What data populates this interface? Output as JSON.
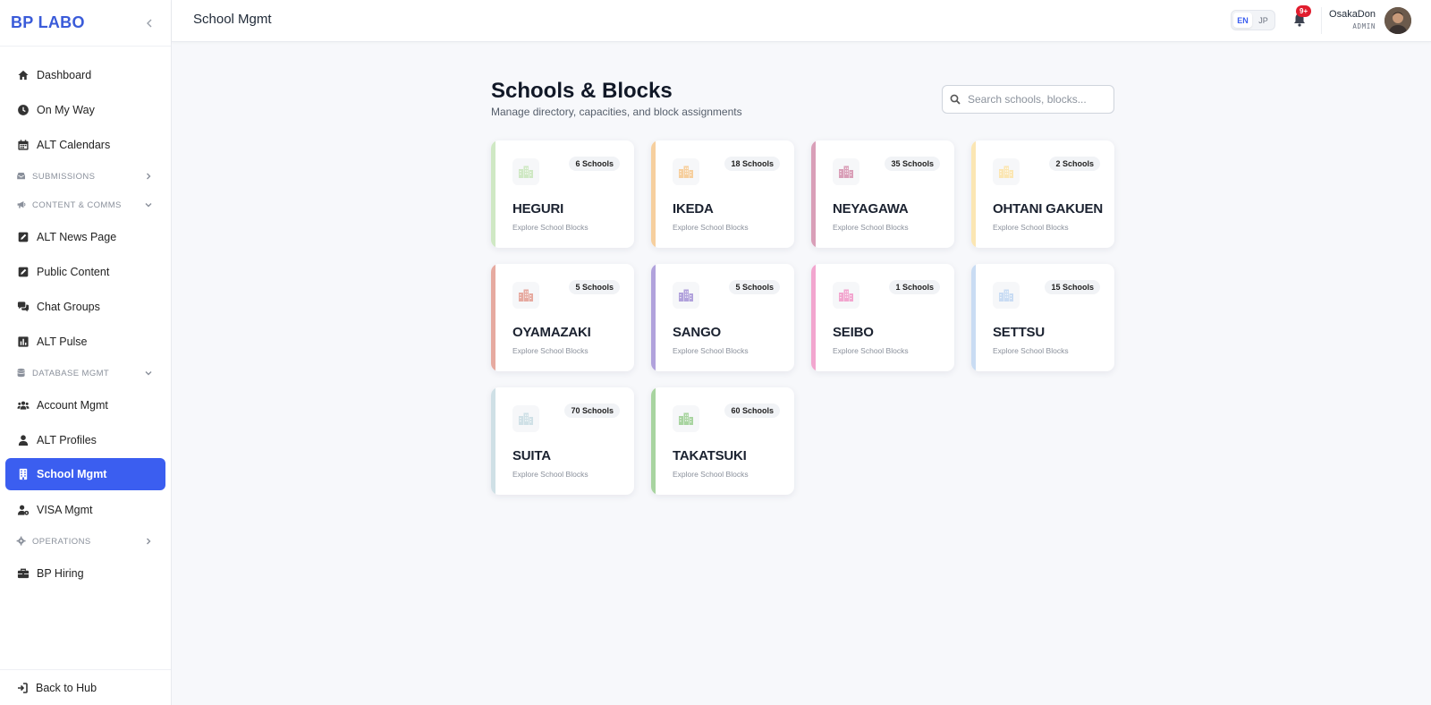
{
  "sidebar": {
    "brand": "BP LABO",
    "items": [
      {
        "type": "item",
        "label": "Dashboard",
        "icon": "home-icon",
        "name": "sidebar-item-dashboard"
      },
      {
        "type": "item",
        "label": "On My Way",
        "icon": "clock-icon",
        "name": "sidebar-item-on-my-way"
      },
      {
        "type": "item",
        "label": "ALT Calendars",
        "icon": "calendar-icon",
        "name": "sidebar-item-alt-calendars"
      },
      {
        "type": "section",
        "label": "SUBMISSIONS",
        "icon": "inbox-icon",
        "chevron": "right",
        "name": "sidebar-section-submissions"
      },
      {
        "type": "section",
        "label": "CONTENT & COMMS",
        "icon": "megaphone-icon",
        "chevron": "down",
        "name": "sidebar-section-content-comms"
      },
      {
        "type": "item",
        "label": "ALT News Page",
        "icon": "edit-icon",
        "name": "sidebar-item-alt-news-page"
      },
      {
        "type": "item",
        "label": "Public Content",
        "icon": "edit-icon",
        "name": "sidebar-item-public-content"
      },
      {
        "type": "item",
        "label": "Chat Groups",
        "icon": "chat-icon",
        "name": "sidebar-item-chat-groups"
      },
      {
        "type": "item",
        "label": "ALT Pulse",
        "icon": "bar-chart-icon",
        "name": "sidebar-item-alt-pulse"
      },
      {
        "type": "section",
        "label": "DATABASE MGMT",
        "icon": "database-icon",
        "chevron": "down",
        "name": "sidebar-section-database-mgmt"
      },
      {
        "type": "item",
        "label": "Account Mgmt",
        "icon": "users-icon",
        "name": "sidebar-item-account-mgmt"
      },
      {
        "type": "item",
        "label": "ALT Profiles",
        "icon": "user-icon",
        "name": "sidebar-item-alt-profiles"
      },
      {
        "type": "item",
        "label": "School Mgmt",
        "icon": "building-icon",
        "active": true,
        "name": "sidebar-item-school-mgmt"
      },
      {
        "type": "item",
        "label": "VISA Mgmt",
        "icon": "user-gear-icon",
        "name": "sidebar-item-visa-mgmt"
      },
      {
        "type": "section",
        "label": "OPERATIONS",
        "icon": "gear-icon",
        "chevron": "right",
        "name": "sidebar-section-operations"
      },
      {
        "type": "item",
        "label": "BP Hiring",
        "icon": "briefcase-icon",
        "name": "sidebar-item-bp-hiring"
      }
    ],
    "footer": {
      "label": "Back to Hub",
      "icon": "sign-in-icon"
    }
  },
  "header": {
    "title": "School Mgmt",
    "lang": {
      "en": "EN",
      "jp": "JP",
      "active": "EN"
    },
    "notifications_badge": "9+",
    "user": {
      "name": "OsakaDon",
      "role": "ADMIN"
    }
  },
  "main": {
    "title": "Schools & Blocks",
    "subtitle": "Manage directory, capacities, and block assignments",
    "search_placeholder": "Search schools, blocks...",
    "cards": [
      {
        "name": "HEGURI",
        "count": "6 Schools",
        "link": "Explore School Blocks",
        "color": "#cfe8c4"
      },
      {
        "name": "IKEDA",
        "count": "18 Schools",
        "link": "Explore School Blocks",
        "color": "#f6cf9e"
      },
      {
        "name": "NEYAGAWA",
        "count": "35 Schools",
        "link": "Explore School Blocks",
        "color": "#d99fb8"
      },
      {
        "name": "OHTANI GAKUEN",
        "count": "2 Schools",
        "link": "Explore School Blocks",
        "color": "#fbe6b3"
      },
      {
        "name": "OYAMAZAKI",
        "count": "5 Schools",
        "link": "Explore School Blocks",
        "color": "#e6aaa0"
      },
      {
        "name": "SANGO",
        "count": "5 Schools",
        "link": "Explore School Blocks",
        "color": "#b1a2dc"
      },
      {
        "name": "SEIBO",
        "count": "1 Schools",
        "link": "Explore School Blocks",
        "color": "#f2a6cf"
      },
      {
        "name": "SETTSU",
        "count": "15 Schools",
        "link": "Explore School Blocks",
        "color": "#c9dcf3"
      },
      {
        "name": "SUITA",
        "count": "70 Schools",
        "link": "Explore School Blocks",
        "color": "#cfe0e6"
      },
      {
        "name": "TAKATSUKI",
        "count": "60 Schools",
        "link": "Explore School Blocks",
        "color": "#a8d4a0"
      }
    ]
  }
}
